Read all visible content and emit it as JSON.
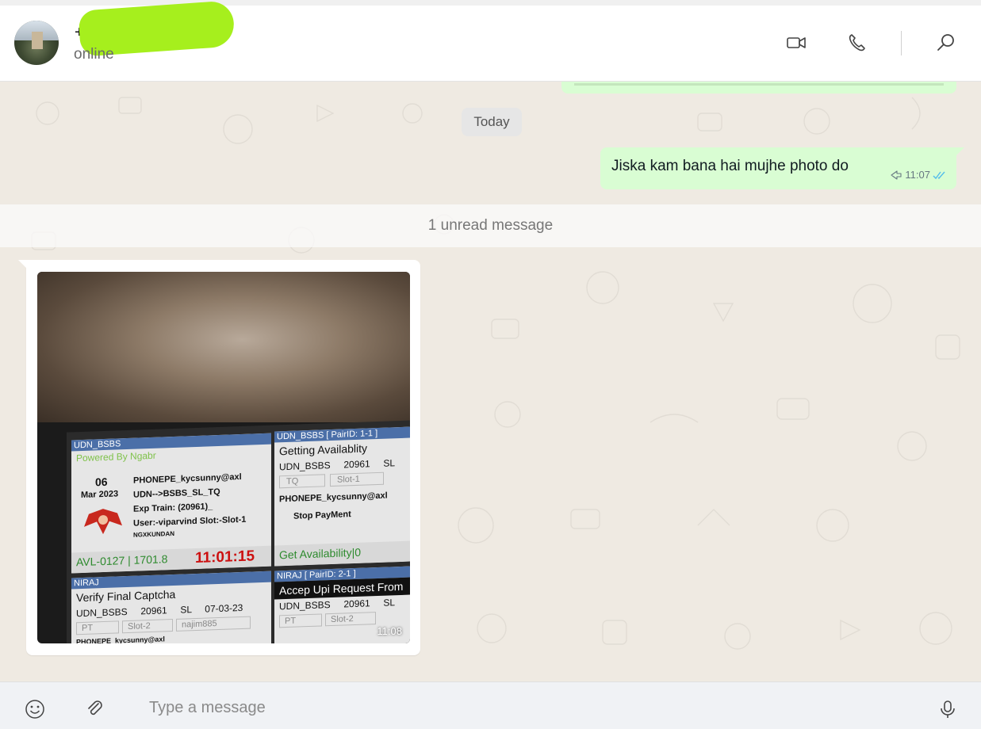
{
  "header": {
    "contact_name": "+9",
    "status": "online",
    "icons": [
      "video-call-icon",
      "voice-call-icon",
      "search-icon"
    ]
  },
  "chat": {
    "date_divider": "Today",
    "outgoing": {
      "text": "Jiska kam bana hai mujhe photo do",
      "time": "11:07"
    },
    "unread_label": "1 unread message",
    "incoming_image": {
      "time": "11:08",
      "panels": {
        "p1_title": "UDN_BSBS",
        "p1_sub": "Powered By Ngabr",
        "p1_day": "06",
        "p1_month": "Mar 2023",
        "p1_line1": "PHONEPE_kycsunny@axl",
        "p1_line2": "UDN-->BSBS_SL_TQ",
        "p1_line3": "Exp Train: (20961)_",
        "p1_line4": "User:-viparvind Slot:-Slot-1",
        "p1_line5": "NGXKUNDAN",
        "p1_avl": "AVL-0127 |  1701.8",
        "p1_clock": "11:01:15",
        "p2_title": "UDN_BSBS [ PairID: 1-1 ]",
        "p2_status": "Getting Availablity",
        "p2_row": "UDN_BSBS     20961     SL",
        "p2_tq": "TQ",
        "p2_slot": "Slot-1",
        "p2_upi": "PHONEPE_kycsunny@axl",
        "p2_stop": "Stop PayMent",
        "p2_get": "Get Availability|0",
        "p3_title": "NIRAJ",
        "p3_status": "Verify Final Captcha",
        "p3_row": "UDN_BSBS     20961     SL     07-03-23",
        "p3_pt": "PT",
        "p3_slot": "Slot-2",
        "p3_user": "najim885",
        "p3_upi": "PHONEPE_kycsunny@axl",
        "p4_title": "NIRAJ [ PairID: 2-1 ]",
        "p4_status": "Accep Upi Request From",
        "p4_row": "UDN_BSBS     20961     SL",
        "p4_pt": "PT",
        "p4_slot": "Slot-2"
      }
    }
  },
  "composer": {
    "placeholder": "Type a message",
    "icons": [
      "emoji-icon",
      "attach-icon",
      "microphone-icon"
    ]
  },
  "colors": {
    "outgoing_bubble": "#d9fdd3",
    "chat_background": "#efeae2",
    "read_ticks": "#53bdeb"
  }
}
